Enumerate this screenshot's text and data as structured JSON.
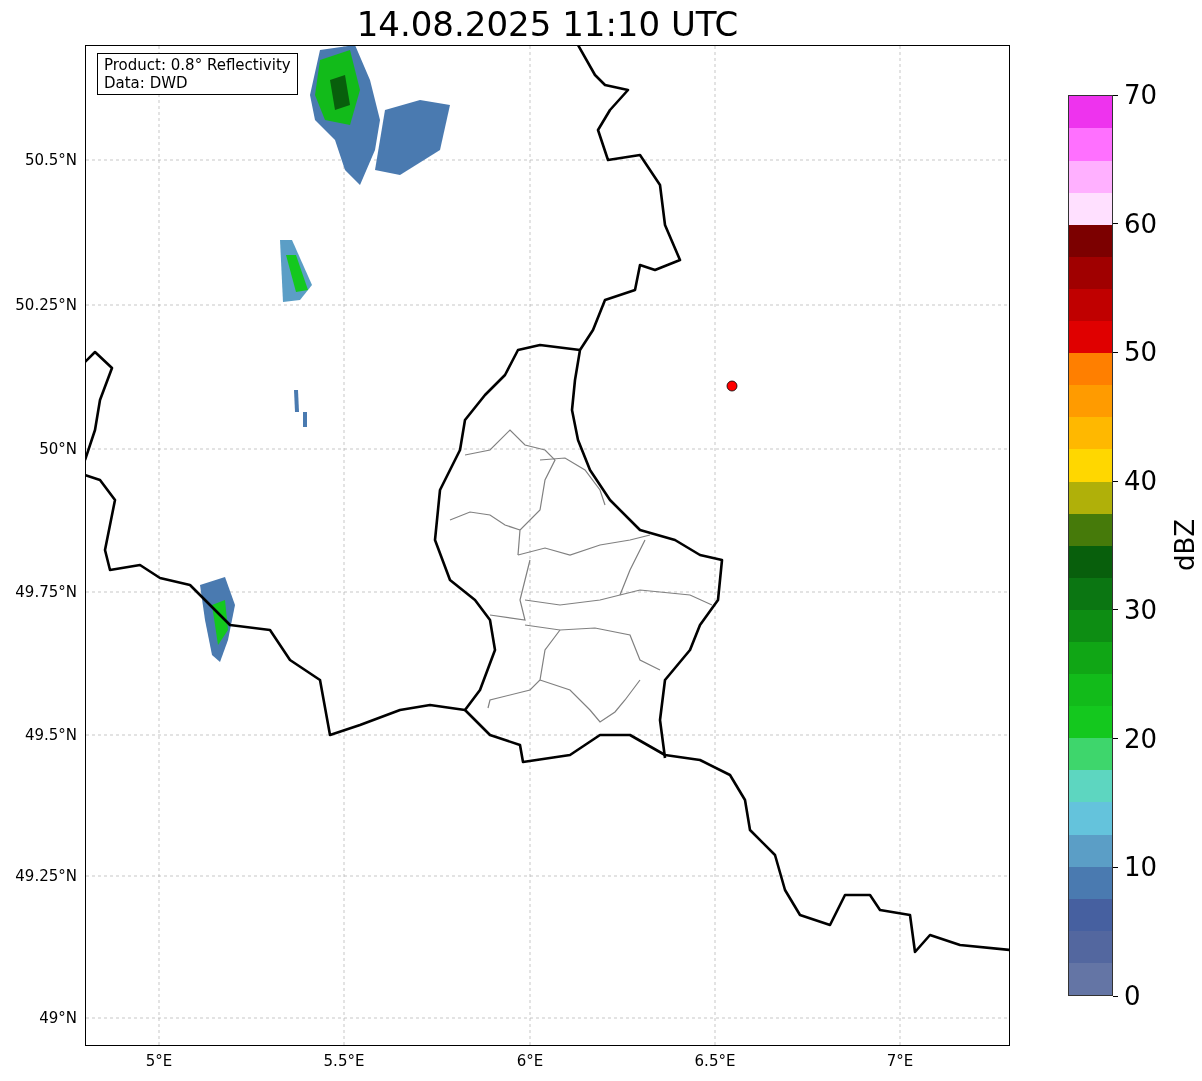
{
  "title": "14.08.2025 11:10 UTC",
  "info_box": [
    "Product: 0.8° Reflectivity",
    "Data: DWD"
  ],
  "map": {
    "lat_labels": [
      "50.5°N",
      "50.25°N",
      "50°N",
      "49.75°N",
      "49.5°N",
      "49.25°N",
      "49°N"
    ],
    "lon_labels": [
      "5°E",
      "5.5°E",
      "6°E",
      "6.5°E",
      "7°E"
    ]
  },
  "colorbar": {
    "label": "dBZ",
    "ticks": [
      "70",
      "60",
      "50",
      "40",
      "30",
      "20",
      "10",
      "0"
    ],
    "segments": [
      {
        "color": "#6475a5"
      },
      {
        "color": "#53679f"
      },
      {
        "color": "#4660a0"
      },
      {
        "color": "#4a7ab0"
      },
      {
        "color": "#5b9ec6"
      },
      {
        "color": "#64c3dc"
      },
      {
        "color": "#5dd6c0"
      },
      {
        "color": "#3ed66c"
      },
      {
        "color": "#14c81e"
      },
      {
        "color": "#12bb1a"
      },
      {
        "color": "#10a615"
      },
      {
        "color": "#0d8d13"
      },
      {
        "color": "#0b7612"
      },
      {
        "color": "#085f0c"
      },
      {
        "color": "#467a0a"
      },
      {
        "color": "#b0b009"
      },
      {
        "color": "#ffd700"
      },
      {
        "color": "#ffb800"
      },
      {
        "color": "#ff9b00"
      },
      {
        "color": "#ff7f00"
      },
      {
        "color": "#e00000"
      },
      {
        "color": "#c00000"
      },
      {
        "color": "#a00000"
      },
      {
        "color": "#7c0000"
      },
      {
        "color": "#ffe0ff"
      },
      {
        "color": "#ffb0ff"
      },
      {
        "color": "#ff70ff"
      },
      {
        "color": "#ee33ee"
      }
    ]
  }
}
